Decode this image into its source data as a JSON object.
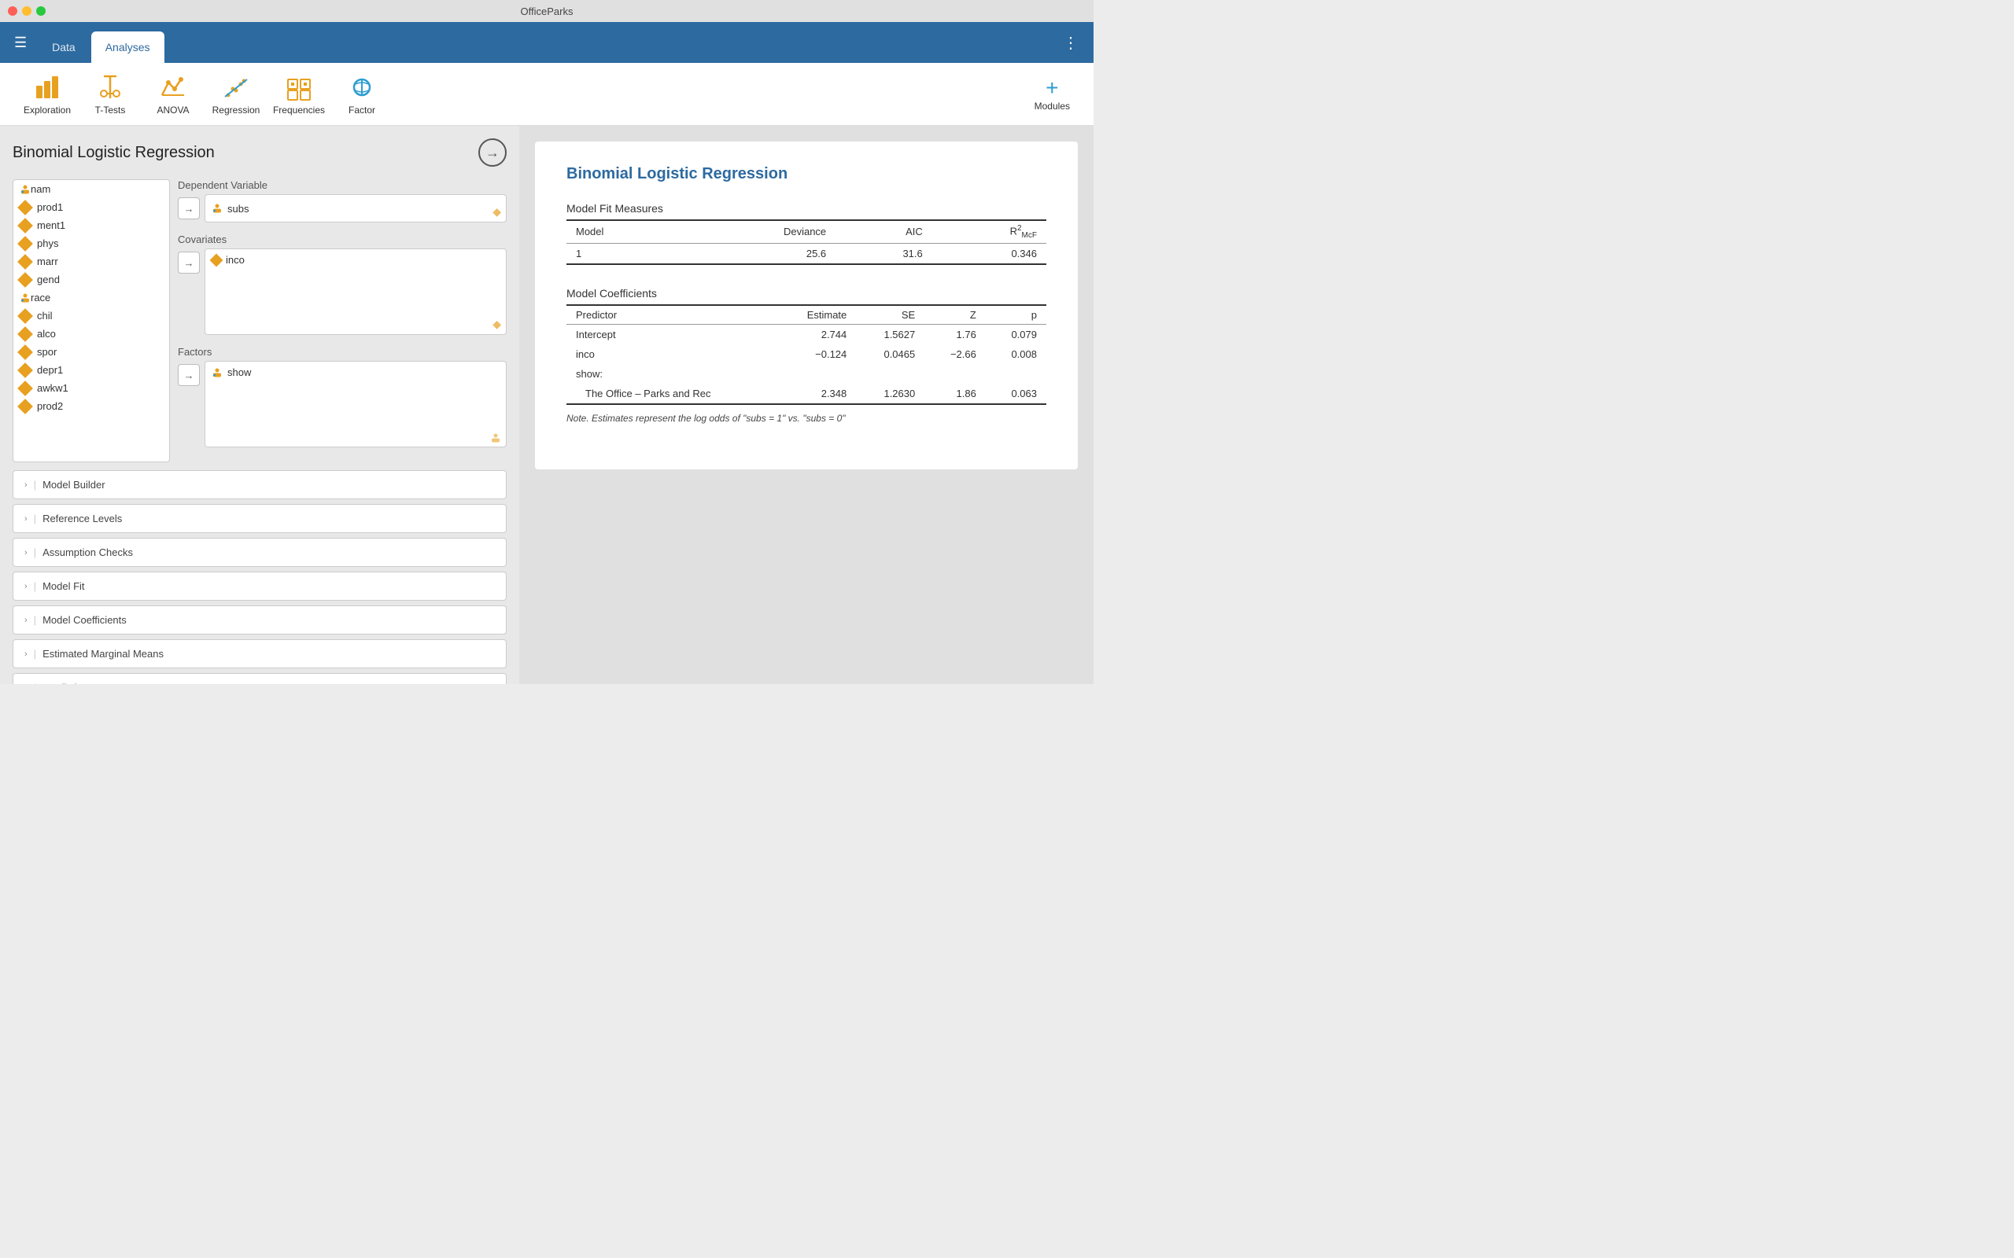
{
  "app": {
    "title": "OfficePark s"
  },
  "titlebar": {
    "title": "OfficeParks"
  },
  "navbar": {
    "hamburger_label": "☰",
    "tabs": [
      {
        "id": "data",
        "label": "Data",
        "active": false
      },
      {
        "id": "analyses",
        "label": "Analyses",
        "active": true
      }
    ],
    "kebab": "⋮"
  },
  "toolbar": {
    "items": [
      {
        "id": "exploration",
        "label": "Exploration"
      },
      {
        "id": "ttests",
        "label": "T-Tests"
      },
      {
        "id": "anova",
        "label": "ANOVA"
      },
      {
        "id": "regression",
        "label": "Regression"
      },
      {
        "id": "frequencies",
        "label": "Frequencies"
      },
      {
        "id": "factor",
        "label": "Factor"
      }
    ],
    "add_label": "Modules"
  },
  "left_panel": {
    "title": "Binomial Logistic Regression",
    "variables": [
      {
        "id": "nam",
        "type": "person",
        "label": "nam"
      },
      {
        "id": "prod1",
        "type": "diamond",
        "label": "prod1"
      },
      {
        "id": "ment1",
        "type": "diamond",
        "label": "ment1"
      },
      {
        "id": "phys",
        "type": "diamond",
        "label": "phys"
      },
      {
        "id": "marr",
        "type": "diamond",
        "label": "marr"
      },
      {
        "id": "gend",
        "type": "diamond",
        "label": "gend"
      },
      {
        "id": "race",
        "type": "person",
        "label": "race"
      },
      {
        "id": "chil",
        "type": "diamond",
        "label": "chil"
      },
      {
        "id": "alco",
        "type": "diamond",
        "label": "alco"
      },
      {
        "id": "spor",
        "type": "diamond",
        "label": "spor"
      },
      {
        "id": "depr1",
        "type": "diamond",
        "label": "depr1"
      },
      {
        "id": "awkw1",
        "type": "diamond",
        "label": "awkw1"
      },
      {
        "id": "prod2",
        "type": "diamond",
        "label": "prod2"
      }
    ],
    "dependent_variable": {
      "label": "Dependent Variable",
      "value": "subs",
      "type": "person"
    },
    "covariates": {
      "label": "Covariates",
      "value": "inco",
      "type": "diamond"
    },
    "factors": {
      "label": "Factors",
      "value": "show",
      "type": "person"
    },
    "sections": [
      {
        "id": "model-builder",
        "label": "Model Builder"
      },
      {
        "id": "reference-levels",
        "label": "Reference Levels"
      },
      {
        "id": "assumption-checks",
        "label": "Assumption Checks"
      },
      {
        "id": "model-fit",
        "label": "Model Fit"
      },
      {
        "id": "model-coefficients",
        "label": "Model Coefficients"
      },
      {
        "id": "estimated-marginal-means",
        "label": "Estimated Marginal Means"
      },
      {
        "id": "prediction",
        "label": "Prediction"
      }
    ]
  },
  "results": {
    "title": "Binomial Logistic Regression",
    "model_fit": {
      "section_title": "Model Fit Measures",
      "headers": [
        "Model",
        "Deviance",
        "AIC",
        "R²MCF"
      ],
      "rows": [
        {
          "model": "1",
          "deviance": "25.6",
          "aic": "31.6",
          "r2": "0.346"
        }
      ]
    },
    "model_coefficients": {
      "section_title": "Model Coefficients",
      "headers": [
        "Predictor",
        "Estimate",
        "SE",
        "Z",
        "p"
      ],
      "rows": [
        {
          "predictor": "Intercept",
          "estimate": "2.744",
          "se": "1.5627",
          "z": "1.76",
          "p": "0.079"
        },
        {
          "predictor": "inco",
          "estimate": "−0.124",
          "se": "0.0465",
          "z": "−2.66",
          "p": "0.008"
        },
        {
          "predictor": "show:",
          "estimate": "",
          "se": "",
          "z": "",
          "p": ""
        },
        {
          "predictor": "  The Office – Parks and Rec",
          "estimate": "2.348",
          "se": "1.2630",
          "z": "1.86",
          "p": "0.063"
        }
      ]
    },
    "note": "Note. Estimates represent the log odds of \"subs = 1\" vs. \"subs = 0\""
  }
}
